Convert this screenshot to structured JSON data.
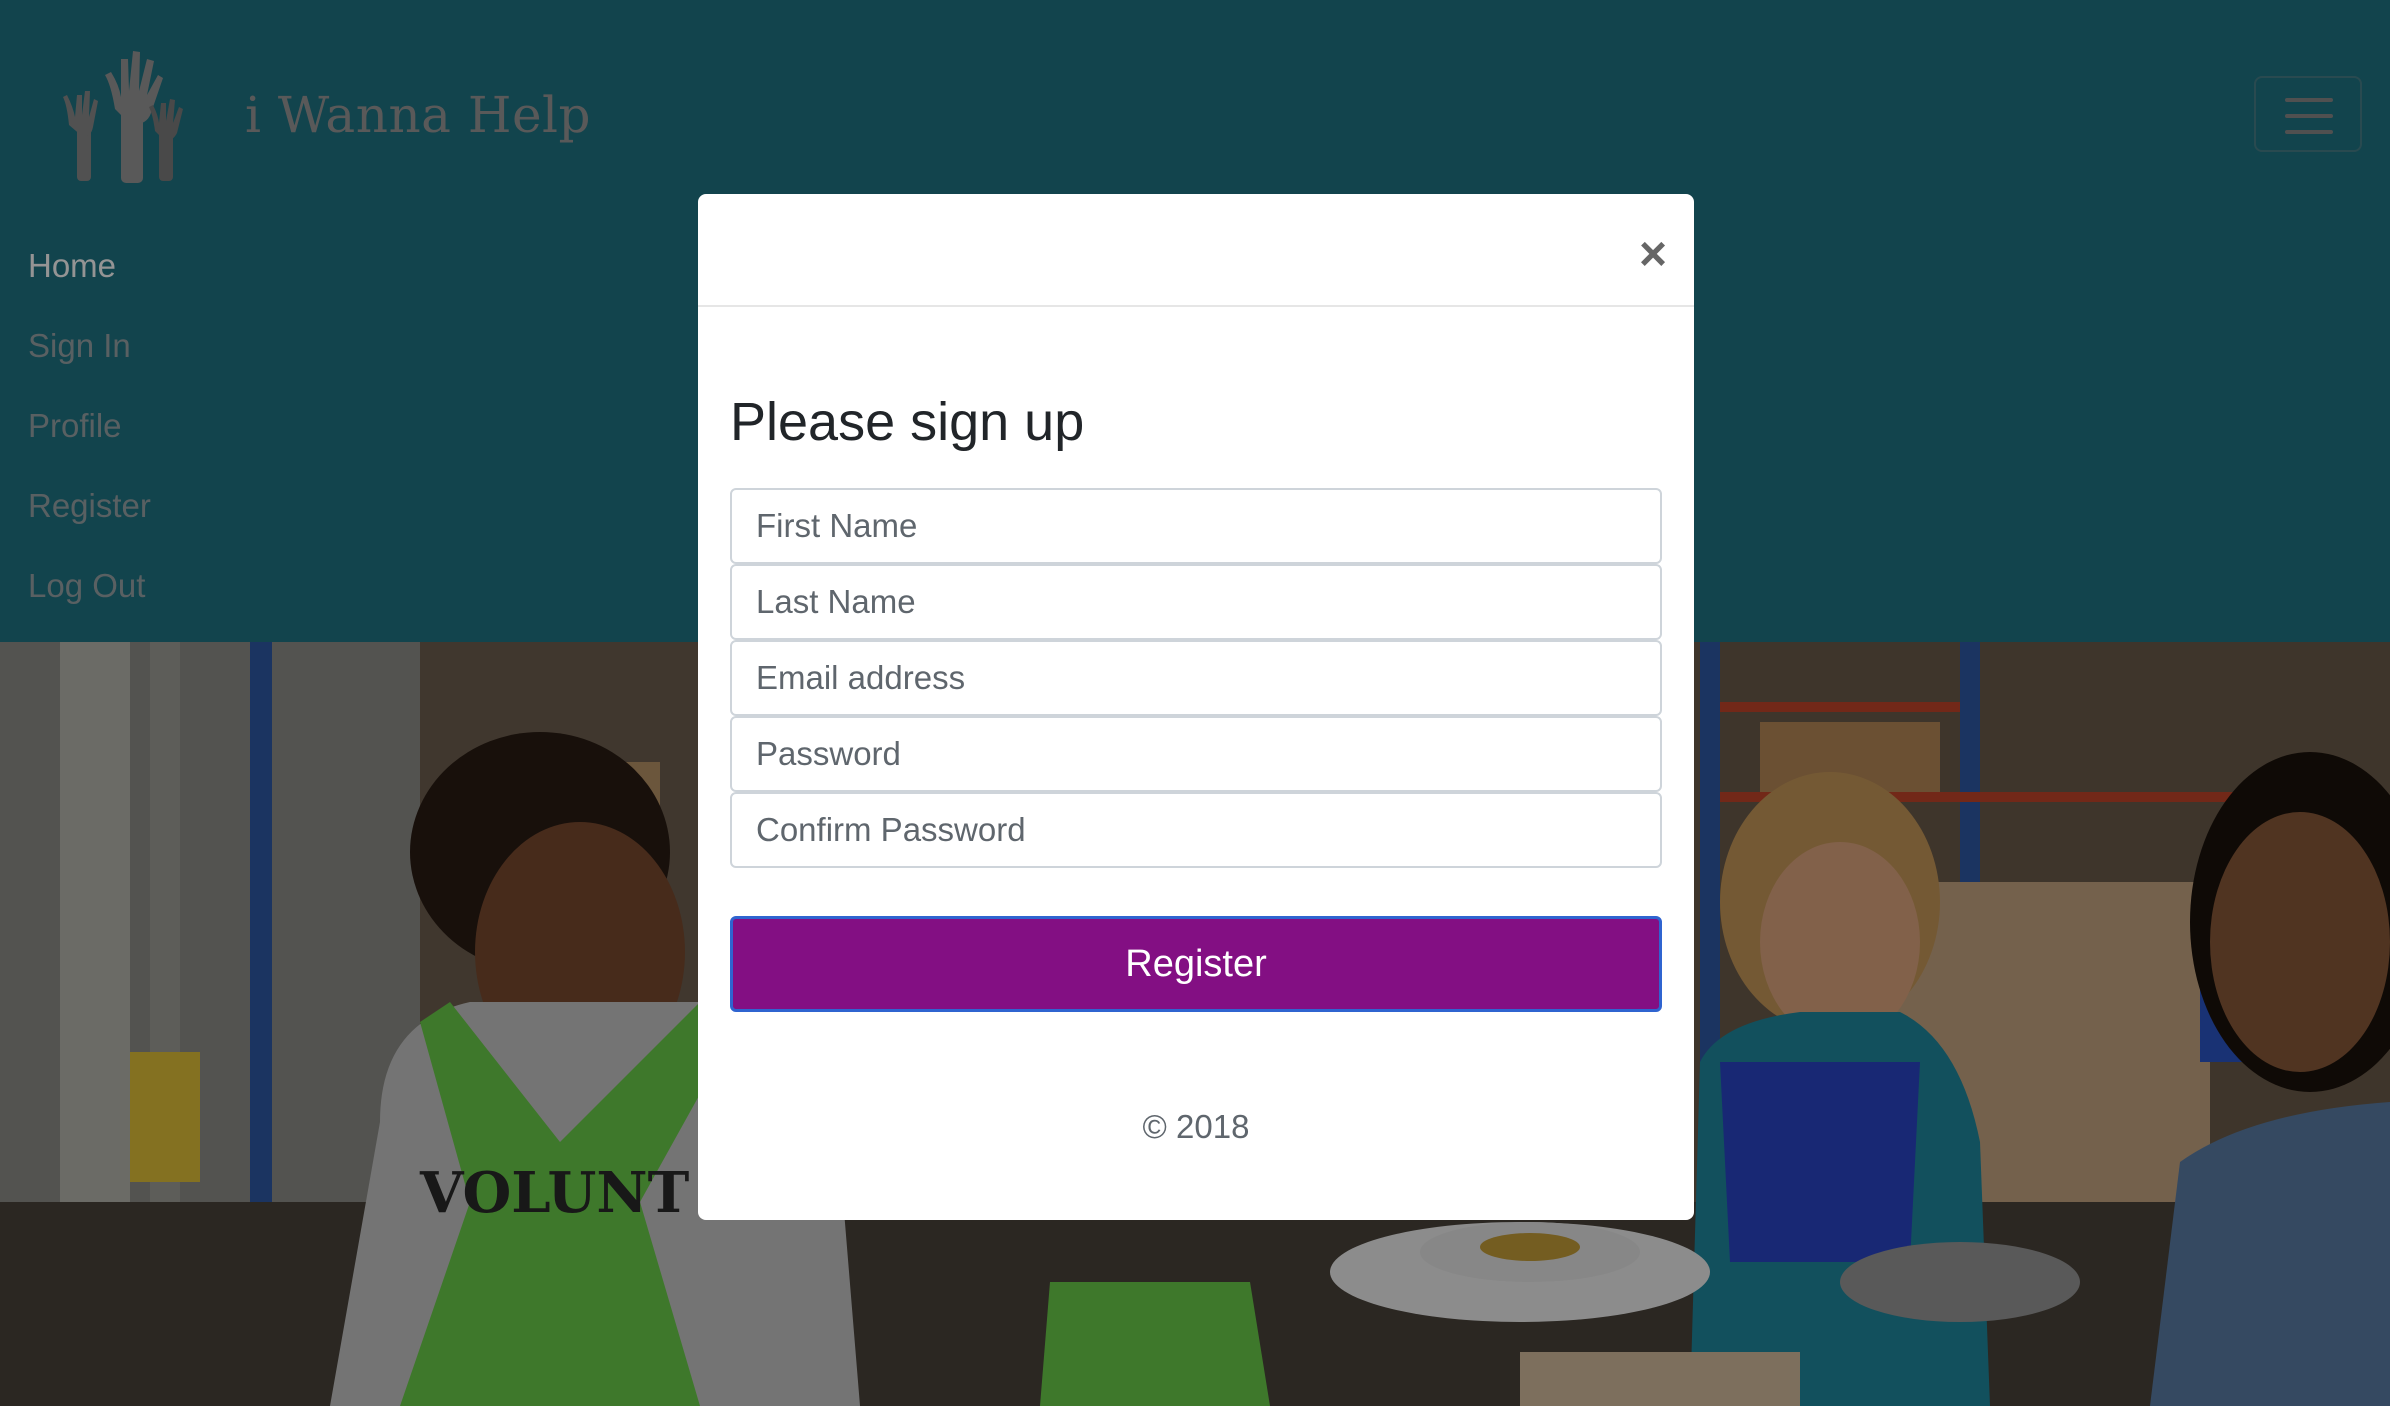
{
  "brand": {
    "name": "i Wanna Help",
    "logo_icon": "raised-hands-icon"
  },
  "navbar": {
    "toggle_icon": "hamburger-menu-icon",
    "items": [
      {
        "label": "Home",
        "active": true
      },
      {
        "label": "Sign In",
        "active": false
      },
      {
        "label": "Profile",
        "active": false
      },
      {
        "label": "Register",
        "active": false
      },
      {
        "label": "Log Out",
        "active": false
      }
    ]
  },
  "hero": {
    "apron_text": "VOLUNT"
  },
  "modal": {
    "close_label": "×",
    "title": "Please sign up",
    "fields": {
      "first_name": {
        "placeholder": "First Name",
        "value": ""
      },
      "last_name": {
        "placeholder": "Last Name",
        "value": ""
      },
      "email": {
        "placeholder": "Email address",
        "value": ""
      },
      "password": {
        "placeholder": "Password",
        "value": ""
      },
      "confirm_password": {
        "placeholder": "Confirm Password",
        "value": ""
      }
    },
    "register_label": "Register",
    "copyright": "© 2018"
  },
  "colors": {
    "navbar_bg": "#1f7585",
    "register_button": "#830f83",
    "register_border": "#2f64d0",
    "nav_active": "#ffffff",
    "nav_inactive": "#9aa6aa"
  }
}
